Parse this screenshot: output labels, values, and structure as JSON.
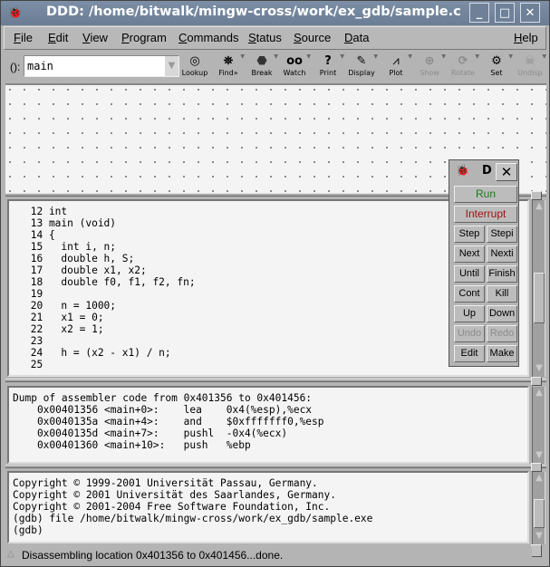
{
  "window": {
    "title": "DDD: /home/bitwalk/mingw-cross/work/ex_gdb/sample.c",
    "controls": {
      "minimize": "_",
      "maximize": "□",
      "close": "✕"
    }
  },
  "menubar": {
    "items": [
      {
        "label": "File",
        "icon": null
      },
      {
        "label": "Edit"
      },
      {
        "label": "View"
      },
      {
        "label": "Program"
      },
      {
        "label": "Commands"
      },
      {
        "label": "Status"
      },
      {
        "label": "Source"
      },
      {
        "label": "Data"
      },
      {
        "label": "Help"
      }
    ]
  },
  "toolbar": {
    "arg_label": "():",
    "arg_value": "main",
    "buttons": [
      {
        "label": "Lookup",
        "icon": "lookup-icon",
        "glyph": "◎",
        "enabled": true,
        "has_menu": false
      },
      {
        "label": "Find»",
        "icon": "binoculars-icon",
        "glyph": "⛯",
        "enabled": true,
        "has_menu": true
      },
      {
        "label": "Break",
        "icon": "stop-sign-icon",
        "glyph": "⬣",
        "enabled": true,
        "has_menu": true
      },
      {
        "label": "Watch",
        "icon": "eyes-icon",
        "glyph": "oo",
        "enabled": true,
        "has_menu": true
      },
      {
        "label": "Print",
        "icon": "question-icon",
        "glyph": "?",
        "enabled": true,
        "has_menu": true
      },
      {
        "label": "Display",
        "icon": "flashlight-icon",
        "glyph": "✎",
        "enabled": true,
        "has_menu": true
      },
      {
        "label": "Plot",
        "icon": "plot-icon",
        "glyph": "⩘",
        "enabled": true,
        "has_menu": true
      },
      {
        "label": "Show",
        "icon": "magnifier-icon",
        "glyph": "⊕",
        "enabled": false,
        "has_menu": true
      },
      {
        "label": "Rotate",
        "icon": "rotate-icon",
        "glyph": "⟳",
        "enabled": false,
        "has_menu": true
      },
      {
        "label": "Set",
        "icon": "set-icon",
        "glyph": "⚙",
        "enabled": true,
        "has_menu": true
      },
      {
        "label": "Undisp",
        "icon": "undisplay-icon",
        "glyph": "☠",
        "enabled": false,
        "has_menu": true
      }
    ]
  },
  "source": {
    "lines": [
      {
        "num": "12",
        "text": "int"
      },
      {
        "num": "13",
        "text": "main (void)"
      },
      {
        "num": "14",
        "text": "{"
      },
      {
        "num": "15",
        "text": "  int i, n;"
      },
      {
        "num": "16",
        "text": "  double h, S;"
      },
      {
        "num": "17",
        "text": "  double x1, x2;"
      },
      {
        "num": "18",
        "text": "  double f0, f1, f2, fn;"
      },
      {
        "num": "19",
        "text": ""
      },
      {
        "num": "20",
        "text": "  n = 1000;"
      },
      {
        "num": "21",
        "text": "  x1 = 0;"
      },
      {
        "num": "22",
        "text": "  x2 = 1;"
      },
      {
        "num": "23",
        "text": ""
      },
      {
        "num": "24",
        "text": "  h = (x2 - x1) / n;"
      },
      {
        "num": "25",
        "text": ""
      }
    ]
  },
  "assembler": {
    "header": "Dump of assembler code from 0x401356 to 0x401456:",
    "rows": [
      {
        "addr": "0x00401356",
        "loc": "<main+0>:",
        "op": "lea",
        "args": "0x4(%esp),%ecx"
      },
      {
        "addr": "0x0040135a",
        "loc": "<main+4>:",
        "op": "and",
        "args": "$0xfffffff0,%esp"
      },
      {
        "addr": "0x0040135d",
        "loc": "<main+7>:",
        "op": "pushl",
        "args": "-0x4(%ecx)"
      },
      {
        "addr": "0x00401360",
        "loc": "<main+10>:",
        "op": "push",
        "args": "%ebp"
      }
    ]
  },
  "console": {
    "lines": [
      "Copyright © 1999-2001 Universität Passau, Germany.",
      "Copyright © 2001 Universität des Saarlandes, Germany.",
      "Copyright © 2001-2004 Free Software Foundation, Inc.",
      "(gdb) file /home/bitwalk/mingw-cross/work/ex_gdb/sample.exe",
      "(gdb) "
    ]
  },
  "status": {
    "message": "Disassembling location 0x401356 to 0x401456...done."
  },
  "command_tool": {
    "title": "D",
    "close": "✕",
    "run": {
      "label": "Run",
      "color": "#1a7a1a"
    },
    "interrupt": {
      "label": "Interrupt",
      "color": "#a01010"
    },
    "pairs": [
      [
        {
          "label": "Step",
          "enabled": true
        },
        {
          "label": "Stepi",
          "enabled": true
        }
      ],
      [
        {
          "label": "Next",
          "enabled": true
        },
        {
          "label": "Nexti",
          "enabled": true
        }
      ],
      [
        {
          "label": "Until",
          "enabled": true
        },
        {
          "label": "Finish",
          "enabled": true
        }
      ],
      [
        {
          "label": "Cont",
          "enabled": true
        },
        {
          "label": "Kill",
          "enabled": true
        }
      ],
      [
        {
          "label": "Up",
          "enabled": true
        },
        {
          "label": "Down",
          "enabled": true
        }
      ],
      [
        {
          "label": "Undo",
          "enabled": false
        },
        {
          "label": "Redo",
          "enabled": false
        }
      ],
      [
        {
          "label": "Edit",
          "enabled": true
        },
        {
          "label": "Make",
          "enabled": true
        }
      ]
    ]
  }
}
